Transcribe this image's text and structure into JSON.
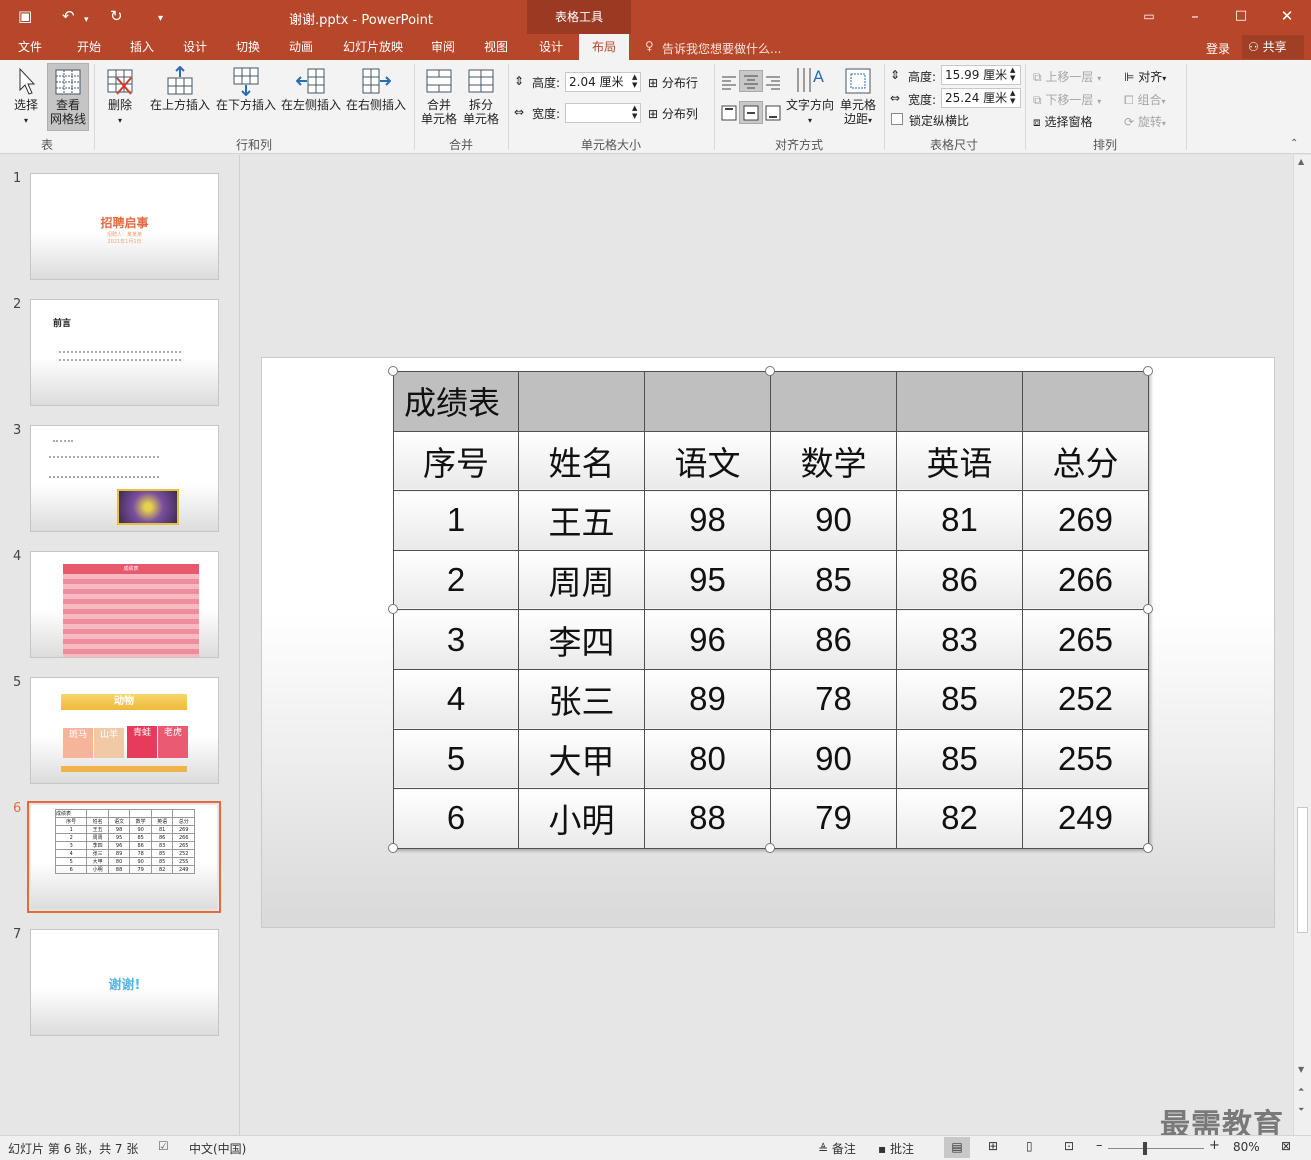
{
  "app": {
    "doc_title": "谢谢.pptx - PowerPoint",
    "context_tools": "表格工具"
  },
  "tabs": [
    {
      "label": "文件"
    },
    {
      "label": "开始"
    },
    {
      "label": "插入"
    },
    {
      "label": "设计"
    },
    {
      "label": "切换"
    },
    {
      "label": "动画"
    },
    {
      "label": "幻灯片放映"
    },
    {
      "label": "审阅"
    },
    {
      "label": "视图"
    },
    {
      "label": "设计"
    },
    {
      "label": "布局"
    }
  ],
  "tellme": "告诉我您想要做什么...",
  "signin": "登录",
  "share": "共享",
  "ribbon": {
    "table": {
      "select": "选择",
      "gridlines_1": "查看",
      "gridlines_2": "网格线",
      "label": "表"
    },
    "rowscols": {
      "delete": "删除",
      "above": "在上方插入",
      "below": "在下方插入",
      "left": "在左侧插入",
      "right": "在右侧插入",
      "label": "行和列"
    },
    "merge": {
      "merge_1": "合并",
      "merge_2": "单元格",
      "split_1": "拆分",
      "split_2": "单元格",
      "label": "合并"
    },
    "cellsize": {
      "height_label": "高度:",
      "height_value": "2.04 厘米",
      "width_label": "宽度:",
      "width_value": "",
      "dist_rows": "分布行",
      "dist_cols": "分布列",
      "label": "单元格大小"
    },
    "align": {
      "text_dir": "文字方向",
      "margins_1": "单元格",
      "margins_2": "边距",
      "label": "对齐方式"
    },
    "tablesize": {
      "height_label": "高度:",
      "height_value": "15.99 厘米",
      "width_label": "宽度:",
      "width_value": "25.24 厘米",
      "lock": "锁定纵横比",
      "label": "表格尺寸"
    },
    "arrange": {
      "forward": "上移一层",
      "backward": "下移一层",
      "pane": "选择窗格",
      "align": "对齐",
      "group": "组合",
      "rotate": "旋转",
      "label": "排列"
    }
  },
  "thumbnails": {
    "slide1": {
      "title": "招聘启事",
      "sub1": "招聘人：某某某",
      "sub2": "2021年1月1日"
    },
    "slide2": {
      "title": "前言"
    },
    "slide4": {
      "title": "成绩表"
    },
    "slide5": {
      "title": "动物",
      "c1": "斑马",
      "c2": "山羊",
      "c3": "青蛙",
      "c4": "老虎"
    },
    "slide7": {
      "title": "谢谢!"
    },
    "numbers": [
      "1",
      "2",
      "3",
      "4",
      "5",
      "6",
      "7"
    ]
  },
  "table": {
    "title": "成绩表",
    "headers": [
      "序号",
      "姓名",
      "语文",
      "数学",
      "英语",
      "总分"
    ],
    "rows": [
      [
        "1",
        "王五",
        "98",
        "90",
        "81",
        "269"
      ],
      [
        "2",
        "周周",
        "95",
        "85",
        "86",
        "266"
      ],
      [
        "3",
        "李四",
        "96",
        "86",
        "83",
        "265"
      ],
      [
        "4",
        "张三",
        "89",
        "78",
        "85",
        "252"
      ],
      [
        "5",
        "大甲",
        "80",
        "90",
        "85",
        "255"
      ],
      [
        "6",
        "小明",
        "88",
        "79",
        "82",
        "249"
      ]
    ]
  },
  "status": {
    "slide_info": "幻灯片 第 6 张，共 7 张",
    "lang": "中文(中国)",
    "notes": "备注",
    "comments": "批注",
    "zoom": "80%",
    "watermark": "最需教育"
  },
  "colors": {
    "accent": "#b7472a",
    "selected_thumb": "#e8693e"
  }
}
